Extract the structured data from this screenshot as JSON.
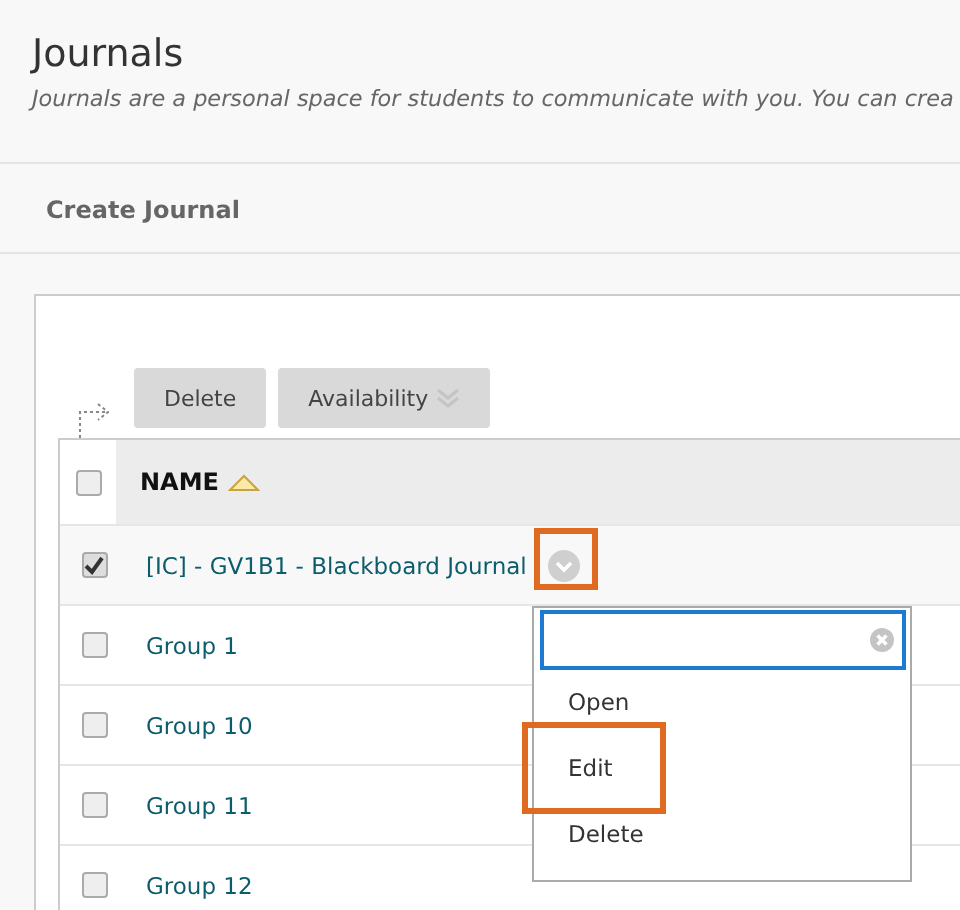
{
  "page": {
    "title": "Journals",
    "description": "Journals are a personal space for students to communicate with you. You can crea"
  },
  "action_bar": {
    "items": [
      {
        "label": "Create Journal"
      }
    ]
  },
  "toolbar": [
    {
      "label": "Delete",
      "kind": "button"
    },
    {
      "label": "Availability",
      "kind": "dropdown"
    }
  ],
  "table": {
    "select_all_checked": false,
    "columns": [
      {
        "label": "NAME",
        "sorted_ascending": true
      }
    ],
    "rows": [
      {
        "name": "[IC] - GV1B1 - Blackboard Journal",
        "checked": true,
        "menu_open": true
      },
      {
        "name": "Group 1",
        "checked": false,
        "menu_open": false
      },
      {
        "name": "Group 10",
        "checked": false,
        "menu_open": false
      },
      {
        "name": "Group 11",
        "checked": false,
        "menu_open": false
      },
      {
        "name": "Group 12",
        "checked": false,
        "menu_open": false
      }
    ]
  },
  "menu": {
    "trigger_highlighted": true,
    "items": [
      {
        "label": "Open",
        "highlighted": false
      },
      {
        "label": "Edit",
        "highlighted": true
      },
      {
        "label": "Delete",
        "highlighted": false
      }
    ]
  }
}
